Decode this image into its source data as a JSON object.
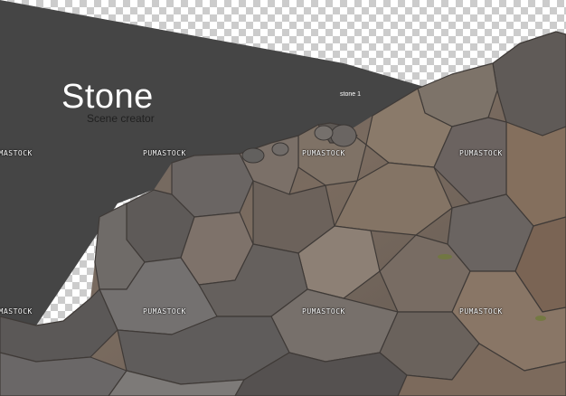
{
  "header": {
    "title": "Stone",
    "subtitle": "Scene creator",
    "caption": "",
    "item_label": "stone 1"
  },
  "watermarks": [
    {
      "text": "PUMASTOCK"
    },
    {
      "text": "PUMASTOCK"
    },
    {
      "text": "PUMASTOCK"
    },
    {
      "text": "PUMASTOCK"
    },
    {
      "text": "PUMASTOCK"
    },
    {
      "text": "PUMASTOCK"
    },
    {
      "text": "PUMASTOCK"
    },
    {
      "text": "PUMASTOCK"
    }
  ],
  "colors": {
    "panel": "#454545",
    "transparency_light": "#ffffff",
    "transparency_dark": "#cccccc",
    "rock_gray": "#6e6a66",
    "rock_brown": "#7a6452"
  },
  "icons": [
    "transparency-checkerboard",
    "rock-cutout"
  ]
}
